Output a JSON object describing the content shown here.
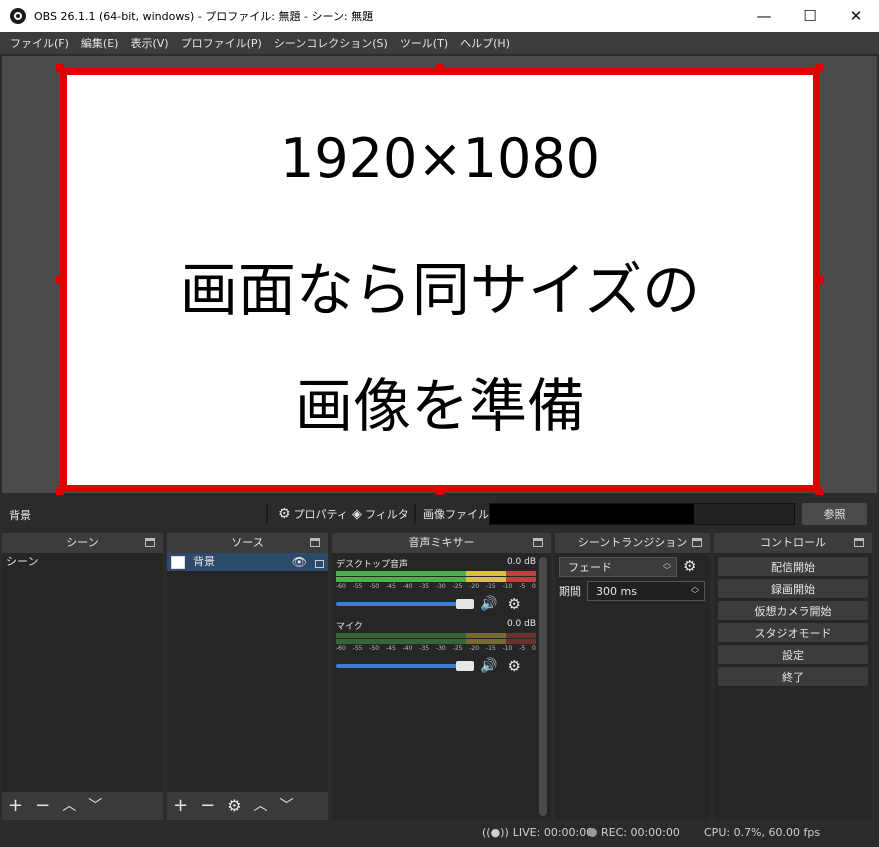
{
  "window": {
    "title": "OBS 26.1.1 (64-bit, windows) - プロファイル: 無題 - シーン: 無題",
    "minimize": "—",
    "maximize": "☐",
    "close": "✕"
  },
  "menu": [
    "ファイル(F)",
    "編集(E)",
    "表示(V)",
    "プロファイル(P)",
    "シーンコレクション(S)",
    "ツール(T)",
    "ヘルプ(H)"
  ],
  "preview": {
    "line1": "1920×1080",
    "line2": "画面なら同サイズの",
    "line3": "画像を準備",
    "border_color": "#e00000"
  },
  "source_toolbar": {
    "selected_source": "背景",
    "properties": "プロパティ",
    "filters": "フィルタ",
    "file_label": "画像ファイル",
    "browse": "参照"
  },
  "docks": {
    "scenes": {
      "title": "シーン",
      "items": [
        "シーン"
      ]
    },
    "sources": {
      "title": "ソース",
      "items": [
        "背景"
      ]
    },
    "mixer": {
      "title": "音声ミキサー",
      "channels": [
        {
          "name": "デスクトップ音声",
          "db": "0.0 dB"
        },
        {
          "name": "マイク",
          "db": "0.0 dB"
        }
      ],
      "ticks": [
        "-60",
        "-55",
        "-50",
        "-45",
        "-40",
        "-35",
        "-30",
        "-25",
        "-20",
        "-15",
        "-10",
        "-5",
        "0"
      ]
    },
    "transitions": {
      "title": "シーントランジション",
      "type": "フェード",
      "duration_label": "期間",
      "duration": "300 ms"
    },
    "controls": {
      "title": "コントロール",
      "buttons": [
        "配信開始",
        "録画開始",
        "仮想カメラ開始",
        "スタジオモード",
        "設定",
        "終了"
      ]
    }
  },
  "status": {
    "live": "LIVE: 00:00:00",
    "rec": "REC: 00:00:00",
    "cpu": "CPU: 0.7%, 60.00 fps"
  }
}
